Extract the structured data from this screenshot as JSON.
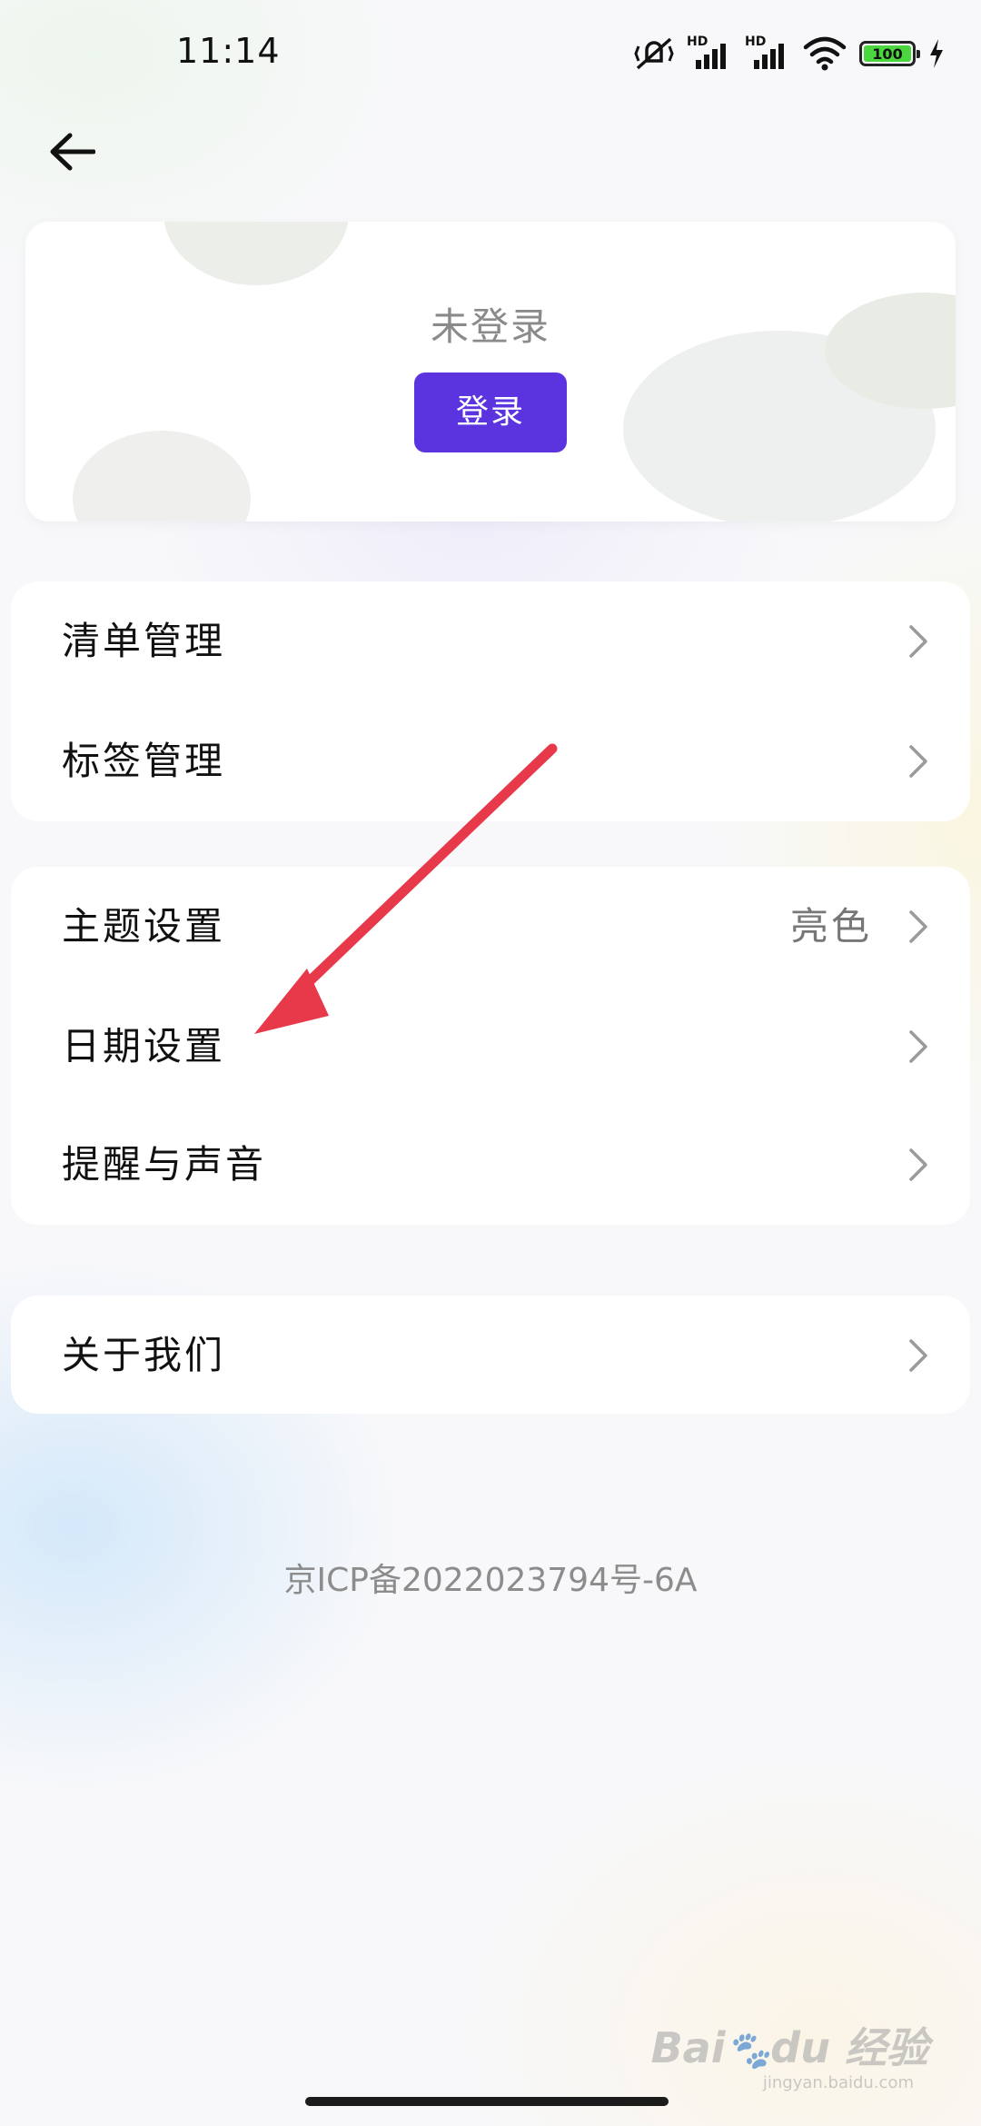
{
  "status_bar": {
    "time": "11:14",
    "network_label": "HD",
    "battery": "100"
  },
  "login_card": {
    "status_text": "未登录",
    "login_button": "登录"
  },
  "menu": {
    "group1": [
      {
        "label": "清单管理"
      },
      {
        "label": "标签管理"
      }
    ],
    "group2": [
      {
        "label": "主题设置",
        "value": "亮色"
      },
      {
        "label": "日期设置"
      },
      {
        "label": "提醒与声音"
      }
    ],
    "group3": [
      {
        "label": "关于我们"
      }
    ]
  },
  "footer": {
    "icp": "京ICP备2022023794号-6A"
  },
  "watermark": {
    "brand": "Bai du 经验",
    "url": "jingyan.baidu.com"
  },
  "annotation": {
    "color": "#e8394b"
  }
}
